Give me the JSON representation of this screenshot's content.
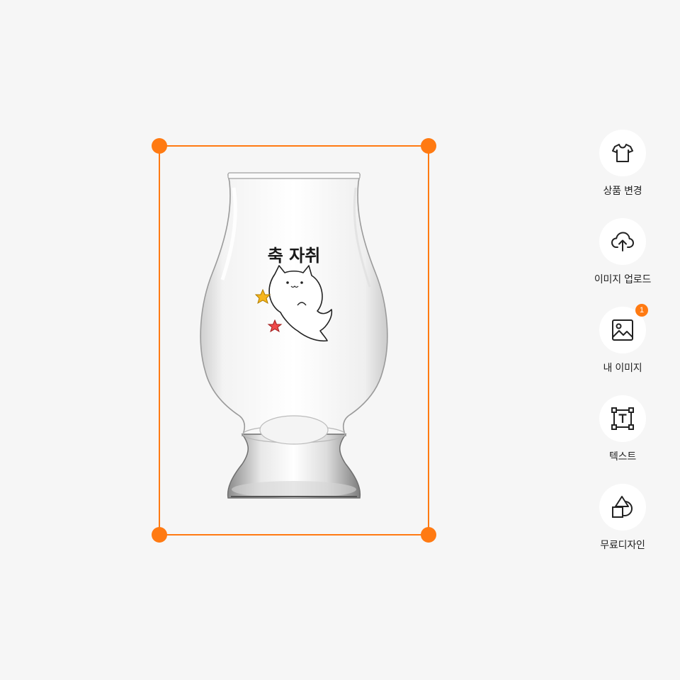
{
  "colors": {
    "accent": "#ff7a12",
    "background": "#f6f6f6",
    "tool_button_bg": "#ffffff",
    "label_text": "#222222"
  },
  "design": {
    "title_text": "축 자취",
    "illustration": "white-cat-ghost-with-stars"
  },
  "toolbar": {
    "items": [
      {
        "label": "상품 변경",
        "icon": "tshirt-icon"
      },
      {
        "label": "이미지 업로드",
        "icon": "cloud-upload-icon"
      },
      {
        "label": "내 이미지",
        "icon": "image-icon",
        "badge": "1"
      },
      {
        "label": "텍스트",
        "icon": "text-box-icon"
      },
      {
        "label": "무료디자인",
        "icon": "shapes-icon"
      }
    ]
  }
}
